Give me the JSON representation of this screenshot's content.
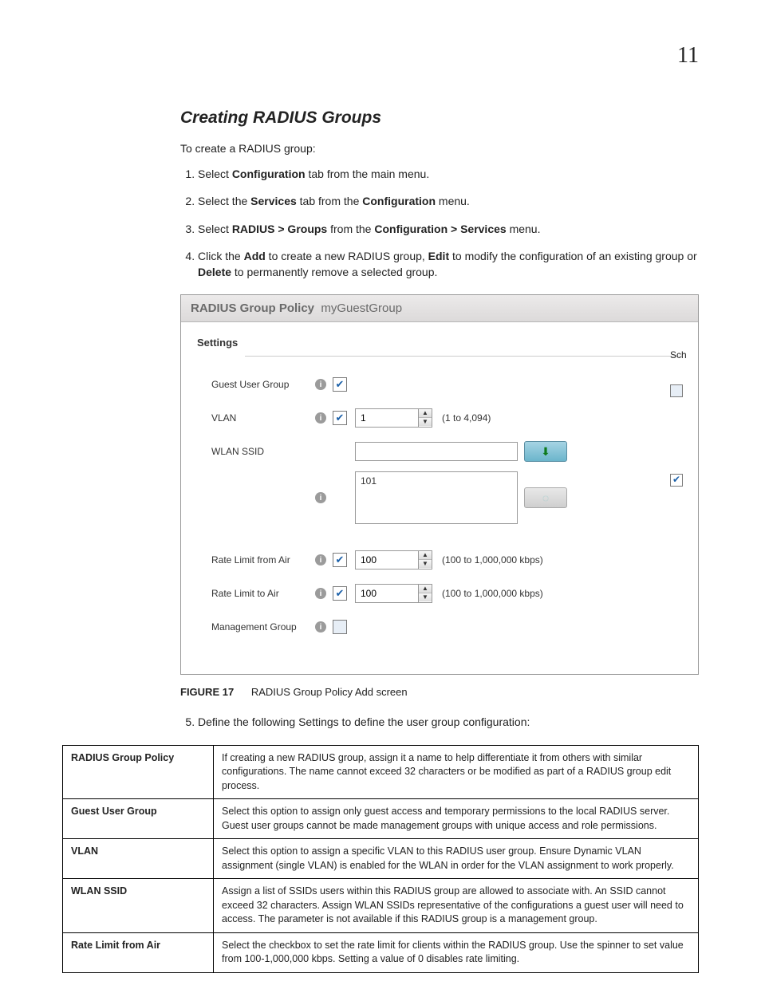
{
  "page_number": "11",
  "heading": "Creating RADIUS Groups",
  "intro": "To create a RADIUS group:",
  "steps": [
    {
      "pre": "Select ",
      "b1": "Configuration",
      "post": " tab from the main menu."
    },
    {
      "pre": "Select the ",
      "b1": "Services",
      "mid": " tab from the ",
      "b2": "Configuration",
      "post": " menu."
    },
    {
      "pre": "Select ",
      "b1": "RADIUS > Groups",
      "mid": " from the ",
      "b2": "Configuration > Services",
      "post": " menu."
    },
    {
      "pre": "Click the ",
      "b1": "Add",
      "mid": " to create a new RADIUS group, ",
      "b2": "Edit",
      "mid2": " to modify the configuration of an existing group or ",
      "b3": "Delete",
      "post": " to permanently remove a selected group."
    }
  ],
  "panel": {
    "title": "RADIUS Group Policy",
    "name": "myGuestGroup",
    "fieldset": "Settings",
    "side_label": "Sch",
    "rows": {
      "guest": {
        "label": "Guest User Group",
        "checked": true
      },
      "vlan": {
        "label": "VLAN",
        "checked": true,
        "value": "1",
        "hint": "(1 to 4,094)"
      },
      "ssid": {
        "label": "WLAN SSID",
        "value": "",
        "list": "101"
      },
      "rate_from": {
        "label": "Rate Limit from Air",
        "checked": true,
        "value": "100",
        "hint": "(100 to 1,000,000 kbps)"
      },
      "rate_to": {
        "label": "Rate Limit to Air",
        "checked": true,
        "value": "100",
        "hint": "(100 to 1,000,000 kbps)"
      },
      "mgmt": {
        "label": "Management Group",
        "checked": false
      }
    }
  },
  "figure": {
    "num": "FIGURE 17",
    "caption": "RADIUS Group Policy Add screen"
  },
  "step5": "Define the following Settings to define the user group configuration:",
  "table": [
    {
      "k": "RADIUS Group Policy",
      "v": "If creating a new RADIUS group, assign it a name to help differentiate it from others with similar configurations. The name cannot exceed 32 characters or be modified as part of a RADIUS group edit process."
    },
    {
      "k": "Guest User Group",
      "v": "Select this option to assign only guest access and temporary permissions to the local RADIUS server. Guest user groups cannot be made management groups with unique access and role permissions."
    },
    {
      "k": "VLAN",
      "v": "Select this option to assign a specific VLAN to this RADIUS user group. Ensure Dynamic VLAN assignment (single VLAN) is enabled for the WLAN in order for the VLAN assignment to work properly."
    },
    {
      "k": "WLAN SSID",
      "v": "Assign a list of SSIDs users within this RADIUS group are allowed to associate with. An SSID cannot exceed 32 characters. Assign WLAN SSIDs representative of the configurations a guest user will need to access. The parameter is not available if this RADIUS group is a management group."
    },
    {
      "k": "Rate Limit from Air",
      "v": "Select the checkbox to set the rate limit for clients within the RADIUS group. Use the spinner to set value from 100-1,000,000 kbps. Setting a value of 0 disables rate limiting."
    }
  ]
}
